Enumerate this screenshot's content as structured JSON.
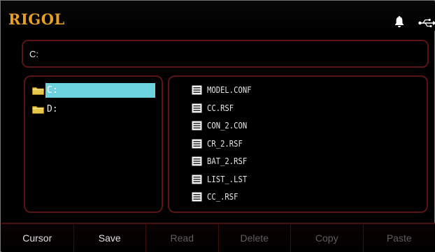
{
  "header": {
    "logo_text": "RIGOL",
    "icons": [
      "bell-icon",
      "usb-icon"
    ],
    "brand_color": "#e8a020"
  },
  "path_bar": {
    "value": "C:"
  },
  "drives": [
    {
      "label": "C:",
      "selected": true
    },
    {
      "label": "D:",
      "selected": false
    }
  ],
  "files": [
    {
      "name": "MODEL.CONF"
    },
    {
      "name": "CC.RSF"
    },
    {
      "name": "CON_2.CON"
    },
    {
      "name": "CR_2.RSF"
    },
    {
      "name": "BAT_2.RSF"
    },
    {
      "name": "LIST_.LST"
    },
    {
      "name": "CC_.RSF"
    }
  ],
  "softkeys": [
    {
      "label": "Cursor",
      "enabled": true
    },
    {
      "label": "Save",
      "enabled": true
    },
    {
      "label": "Read",
      "enabled": false
    },
    {
      "label": "Delete",
      "enabled": false
    },
    {
      "label": "Copy",
      "enabled": false
    },
    {
      "label": "Paste",
      "enabled": false
    }
  ],
  "colors": {
    "selection": "#6cd3de",
    "panel_border": "#5b1414",
    "folder": "#e8c84a"
  }
}
